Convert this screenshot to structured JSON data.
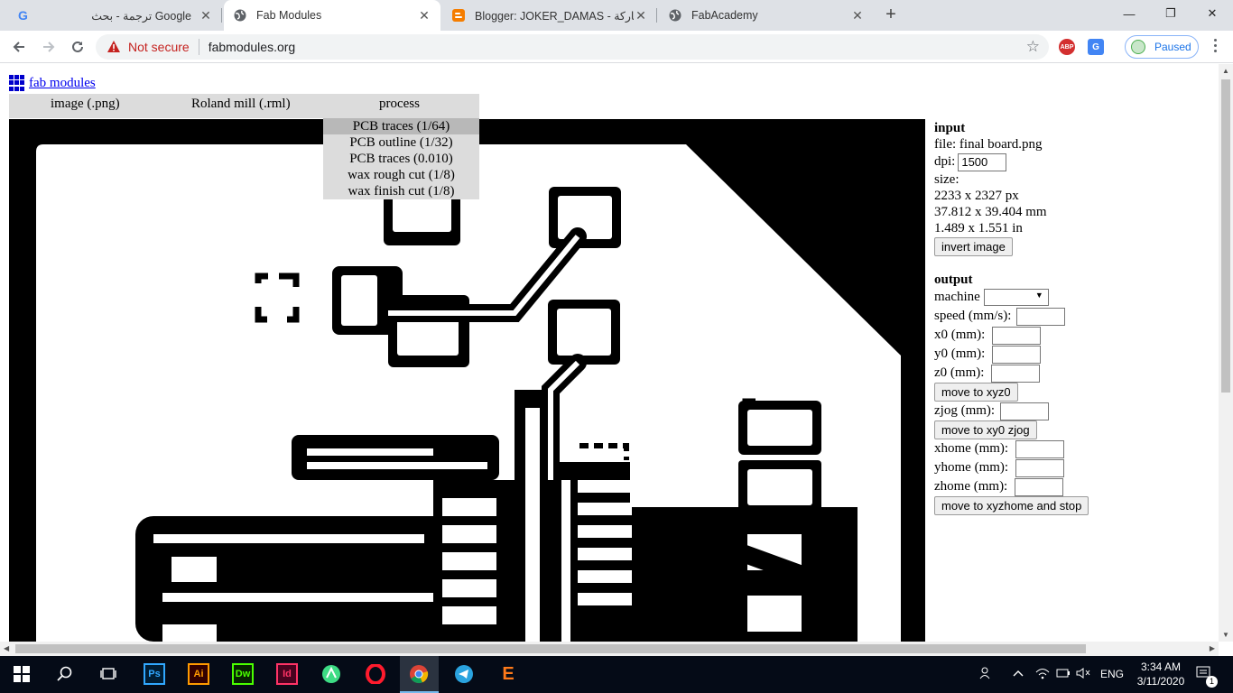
{
  "browser": {
    "tabs": [
      {
        "title": "ترجمة - بحث Google",
        "icon": "google-icon",
        "active": false
      },
      {
        "title": "Fab Modules",
        "icon": "globe-icon",
        "active": true
      },
      {
        "title": "Blogger: JOKER_DAMAS - مشاركة",
        "icon": "blogger-icon",
        "active": false
      },
      {
        "title": "FabAcademy",
        "icon": "globe-icon",
        "active": false
      }
    ],
    "security_label": "Not secure",
    "url": "fabmodules.org",
    "profile_label": "Paused",
    "extensions": [
      "ABP"
    ]
  },
  "page": {
    "logo_text": "fab modules",
    "menu": {
      "input_format": "image (.png)",
      "output_format": "Roland mill (.rml)",
      "process": "process"
    },
    "process_options": [
      "PCB traces (1/64)",
      "PCB outline (1/32)",
      "PCB traces (0.010)",
      "wax rough cut (1/8)",
      "wax finish cut (1/8)"
    ],
    "input": {
      "heading": "input",
      "file": "file: final board.png",
      "dpi_label": "dpi:",
      "dpi_value": "1500",
      "size_label": "size:",
      "size_px": "2233 x 2327 px",
      "size_mm": "37.812 x 39.404 mm",
      "size_in": "1.489 x 1.551 in",
      "invert_button": "invert image"
    },
    "output": {
      "heading": "output",
      "machine_label": "machine",
      "speed_label": "speed (mm/s):",
      "x0_label": "x0 (mm):",
      "y0_label": "y0 (mm):",
      "z0_label": "z0 (mm):",
      "move_xyz0_button": "move to xyz0",
      "zjog_label": "zjog (mm):",
      "move_xy0_button": "move to xy0 zjog",
      "xhome_label": "xhome (mm):",
      "yhome_label": "yhome (mm):",
      "zhome_label": "zhome (mm):",
      "move_home_button": "move to xyzhome and stop"
    }
  },
  "taskbar": {
    "apps": [
      "Ps",
      "Ai",
      "Dw",
      "Id"
    ],
    "language": "ENG",
    "time": "3:34 AM",
    "date": "3/11/2020",
    "notification_count": "1"
  }
}
